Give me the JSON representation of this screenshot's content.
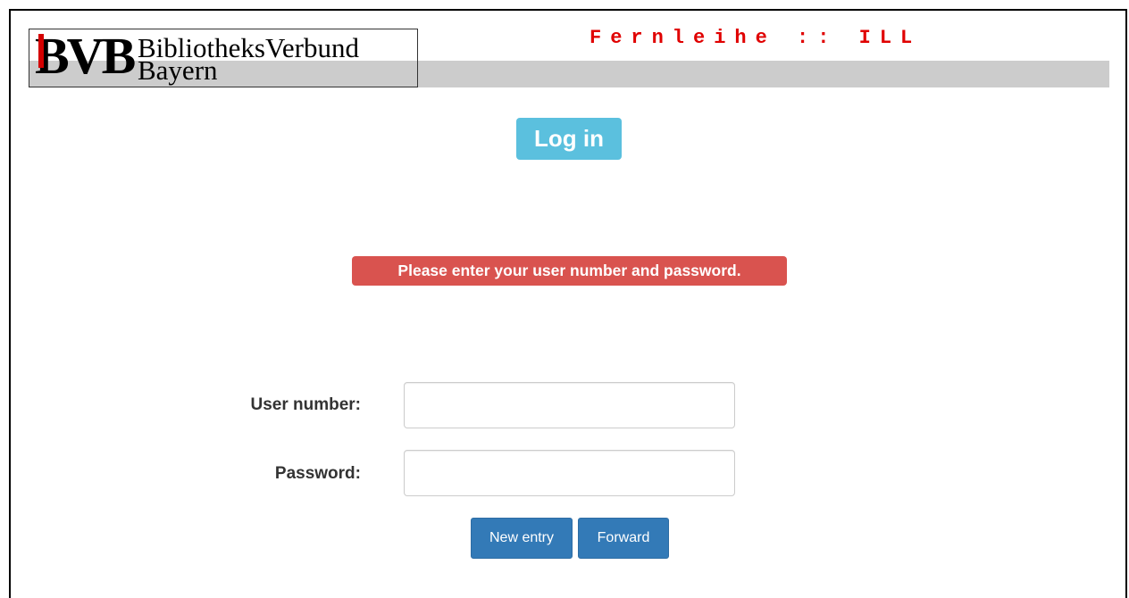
{
  "header": {
    "logo_mark": "BVB",
    "logo_line1": "BibliotheksVerbund",
    "logo_line2": "Bayern",
    "app_title": "Fernleihe :: ILL"
  },
  "main": {
    "heading": "Log in",
    "error_message": "Please enter your user number and password."
  },
  "form": {
    "user_label": "User number:",
    "user_value": "",
    "password_label": "Password:",
    "password_value": "",
    "new_entry_label": "New entry",
    "forward_label": "Forward"
  },
  "colors": {
    "title_red": "#e00000",
    "heading_bg": "#5bc0de",
    "error_bg": "#d9534f",
    "button_bg": "#337ab7",
    "header_grey": "#cccccc"
  }
}
